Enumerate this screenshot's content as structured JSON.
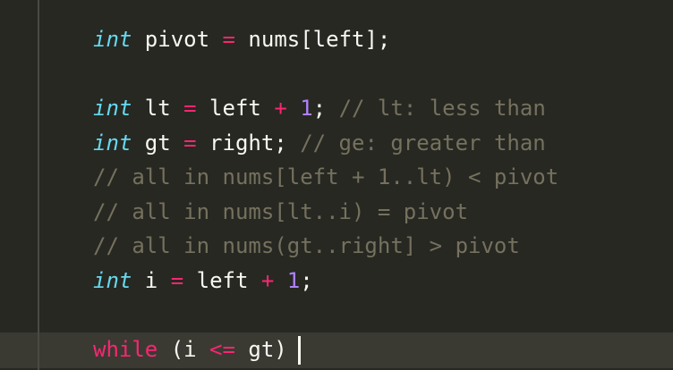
{
  "editor": {
    "lines": [
      {
        "tokens": [
          {
            "t": "int",
            "c": "kw-type"
          },
          {
            "t": " pivot ",
            "c": "plain"
          },
          {
            "t": "=",
            "c": "op"
          },
          {
            "t": " nums[left];",
            "c": "plain"
          }
        ]
      },
      {
        "tokens": []
      },
      {
        "tokens": [
          {
            "t": "int",
            "c": "kw-type"
          },
          {
            "t": " lt ",
            "c": "plain"
          },
          {
            "t": "=",
            "c": "op"
          },
          {
            "t": " left ",
            "c": "plain"
          },
          {
            "t": "+",
            "c": "op"
          },
          {
            "t": " ",
            "c": "plain"
          },
          {
            "t": "1",
            "c": "num"
          },
          {
            "t": "; ",
            "c": "plain"
          },
          {
            "t": "// lt: less than",
            "c": "comment"
          }
        ]
      },
      {
        "tokens": [
          {
            "t": "int",
            "c": "kw-type"
          },
          {
            "t": " gt ",
            "c": "plain"
          },
          {
            "t": "=",
            "c": "op"
          },
          {
            "t": " right; ",
            "c": "plain"
          },
          {
            "t": "// ge: greater than",
            "c": "comment"
          }
        ]
      },
      {
        "tokens": [
          {
            "t": "// all in nums[left + 1..lt) < pivot",
            "c": "comment"
          }
        ]
      },
      {
        "tokens": [
          {
            "t": "// all in nums[lt..i) = pivot",
            "c": "comment"
          }
        ]
      },
      {
        "tokens": [
          {
            "t": "// all in nums(gt..right] > pivot",
            "c": "comment"
          }
        ]
      },
      {
        "tokens": [
          {
            "t": "int",
            "c": "kw-type"
          },
          {
            "t": " i ",
            "c": "plain"
          },
          {
            "t": "=",
            "c": "op"
          },
          {
            "t": " left ",
            "c": "plain"
          },
          {
            "t": "+",
            "c": "op"
          },
          {
            "t": " ",
            "c": "plain"
          },
          {
            "t": "1",
            "c": "num"
          },
          {
            "t": ";",
            "c": "plain"
          }
        ]
      },
      {
        "tokens": []
      },
      {
        "tokens": [
          {
            "t": "while",
            "c": "kw-ctrl"
          },
          {
            "t": " (i ",
            "c": "plain"
          },
          {
            "t": "<=",
            "c": "op"
          },
          {
            "t": " gt)",
            "c": "plain"
          }
        ],
        "cursor": true
      }
    ]
  },
  "theme": {
    "background": "#272822",
    "current_line": "#3a3a33",
    "foreground": "#f8f8f2",
    "keyword_type": "#66d9ef",
    "keyword_control": "#f92672",
    "number": "#ae81ff",
    "comment": "#75715e"
  }
}
